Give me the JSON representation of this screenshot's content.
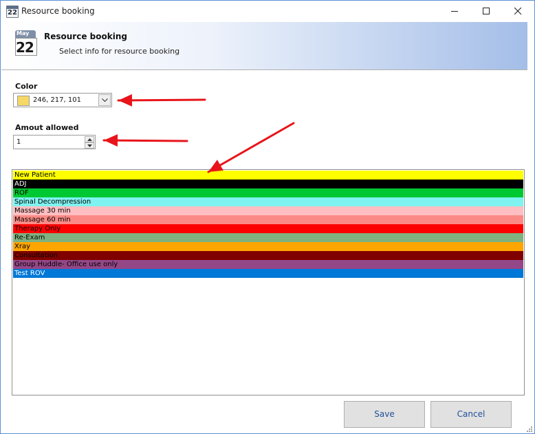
{
  "window": {
    "title": "Resource booking",
    "icon_day": "22"
  },
  "banner": {
    "title": "Resource booking",
    "subtitle": "Select info for resource booking",
    "calendar_month": "May",
    "calendar_day": "22"
  },
  "color": {
    "label": "Color",
    "value": "246, 217, 101",
    "swatch": "#f6d965"
  },
  "amount": {
    "label": "Amout allowed",
    "value": "1"
  },
  "resources": [
    {
      "label": "New Patient",
      "bg": "#ffff00",
      "fg": "#000000"
    },
    {
      "label": "ADJ",
      "bg": "#000000",
      "fg": "#ffffff"
    },
    {
      "label": "ROF",
      "bg": "#00c832",
      "fg": "#000000"
    },
    {
      "label": "Spinal Decompression",
      "bg": "#7ff3f0",
      "fg": "#000000"
    },
    {
      "label": "Massage 30 min",
      "bg": "#ffbfc2",
      "fg": "#000000"
    },
    {
      "label": "Massage 60 min",
      "bg": "#fb8a86",
      "fg": "#000000"
    },
    {
      "label": "Therapy Only",
      "bg": "#ff0000",
      "fg": "#000000"
    },
    {
      "label": "Re-Exam",
      "bg": "#7fb27f",
      "fg": "#000000"
    },
    {
      "label": "Xray",
      "bg": "#ffa500",
      "fg": "#000000"
    },
    {
      "label": "Consultation",
      "bg": "#800000",
      "fg": "#000000"
    },
    {
      "label": "Group Huddle- Office use only",
      "bg": "#944787",
      "fg": "#000000"
    },
    {
      "label": "Test ROV",
      "bg": "#0078d7",
      "fg": "#ffffff"
    }
  ],
  "buttons": {
    "save": "Save",
    "cancel": "Cancel"
  },
  "annotation_color": "#e8141a"
}
